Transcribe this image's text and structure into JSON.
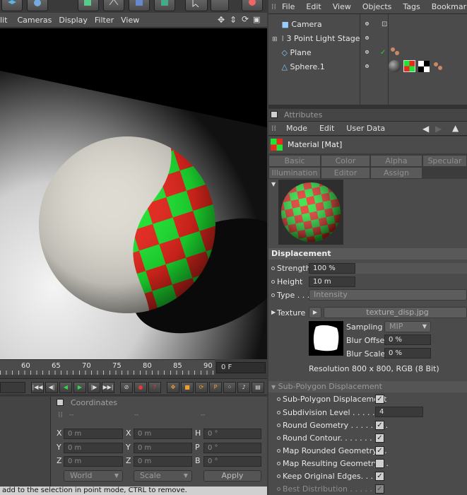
{
  "viewport_menu": [
    "lit",
    "Cameras",
    "Display",
    "Filter",
    "View"
  ],
  "object_menu": [
    "File",
    "Edit",
    "View",
    "Objects",
    "Tags",
    "Bookmarks"
  ],
  "objects": [
    "Camera",
    "3 Point Light Stage",
    "Plane",
    "Sphere.1"
  ],
  "timeline": {
    "ticks": [
      "60",
      "65",
      "70",
      "75",
      "80",
      "85",
      "90"
    ],
    "current_frame": "0 F"
  },
  "coordinates": {
    "title": "Coordinates",
    "rows": [
      {
        "a": "X",
        "a_val": "0 m",
        "b": "X",
        "b_val": "0 m",
        "c": "H",
        "c_val": "0 °"
      },
      {
        "a": "Y",
        "a_val": "0 m",
        "b": "Y",
        "b_val": "0 m",
        "c": "P",
        "c_val": "0 °"
      },
      {
        "a": "Z",
        "a_val": "0 m",
        "b": "Z",
        "b_val": "0 m",
        "c": "B",
        "c_val": "0 °"
      }
    ],
    "dashes": [
      "--",
      "--",
      "--"
    ],
    "world_label": "World",
    "scale_label": "Scale",
    "apply_label": "Apply"
  },
  "status_text": "add to the selection in point mode, CTRL to remove.",
  "attributes": {
    "header": "Attributes",
    "menu": [
      "Mode",
      "Edit",
      "User Data"
    ],
    "material_title": "Material [Mat]",
    "tabs_row1": [
      "Basic",
      "Color",
      "Alpha",
      "Specular"
    ],
    "tabs_row2": [
      "Illumination",
      "Editor",
      "Assign"
    ]
  },
  "displacement": {
    "section": "Displacement",
    "strength_label": "Strength",
    "strength_value": "100 %",
    "height_label": "Height",
    "height_value": "10 m",
    "type_label": "Type . . .",
    "type_value": "Intensity",
    "texture_label": "Texture",
    "texture_file": "texture_disp.jpg",
    "sampling_label": "Sampling",
    "sampling_value": "MIP",
    "blur_offset_label": "Blur Offset",
    "blur_offset_value": "0 %",
    "blur_scale_label": "Blur Scale",
    "blur_scale_value": "0 %",
    "resolution": "Resolution 800 x 800, RGB (8 Bit)"
  },
  "subpoly": {
    "section": "Sub-Polygon Displacement",
    "items": [
      {
        "label": "Sub-Polygon Displacement",
        "checked": true
      },
      {
        "label": "Subdivision Level . . . . . . .",
        "value": "4"
      },
      {
        "label": "Round Geometry . . . . . . . .",
        "checked": true
      },
      {
        "label": "Round Contour. . . . . . . . .",
        "checked": true
      },
      {
        "label": "Map Rounded Geometry . .",
        "checked": true
      },
      {
        "label": "Map Resulting Geometry . .",
        "checked": false
      },
      {
        "label": "Keep Original Edges. . . . .",
        "checked": true
      },
      {
        "label": "Best Distribution . . . . . . .",
        "checked": true
      }
    ]
  },
  "colors": {
    "checker_red": "#e8281e",
    "checker_green": "#1ee632",
    "section_bg": "#595959"
  }
}
